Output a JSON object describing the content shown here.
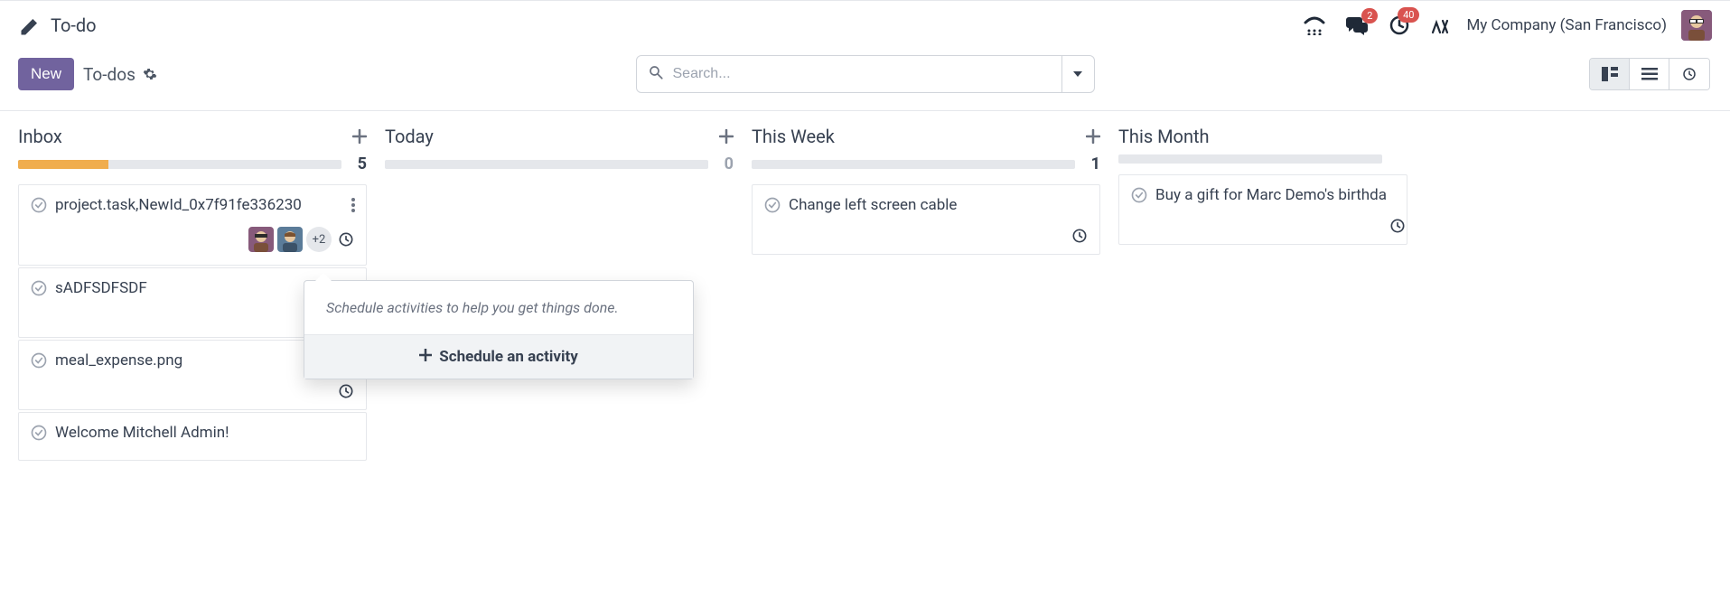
{
  "header": {
    "app_title": "To-do",
    "company": "My Company (San Francisco)",
    "badges": {
      "messages": "2",
      "activities": "40"
    }
  },
  "controlbar": {
    "new_label": "New",
    "breadcrumb": "To-dos",
    "search_placeholder": "Search..."
  },
  "columns": [
    {
      "title": "Inbox",
      "count": "5",
      "progress_pct": 28,
      "cards": [
        {
          "title": "project.task,NewId_0x7f91fe336230",
          "has_kebab": true,
          "avatars": 2,
          "plus": "+2",
          "clock": true
        },
        {
          "title": "sADFSDFSDF"
        },
        {
          "title": "meal_expense.png",
          "clock_br": true
        },
        {
          "title": "Welcome Mitchell Admin!"
        }
      ]
    },
    {
      "title": "Today",
      "count": "0",
      "progress_pct": 0,
      "cards": []
    },
    {
      "title": "This Week",
      "count": "1",
      "progress_pct": 0,
      "cards": [
        {
          "title": "Change left screen cable",
          "clock_br": true
        }
      ]
    },
    {
      "title": "This Month",
      "count": "",
      "progress_pct": 0,
      "cards": [
        {
          "title": "Buy a gift for Marc Demo's birthda",
          "clock_br": true
        }
      ]
    }
  ],
  "popover": {
    "body": "Schedule activities to help you get things done.",
    "action": "Schedule an activity"
  }
}
